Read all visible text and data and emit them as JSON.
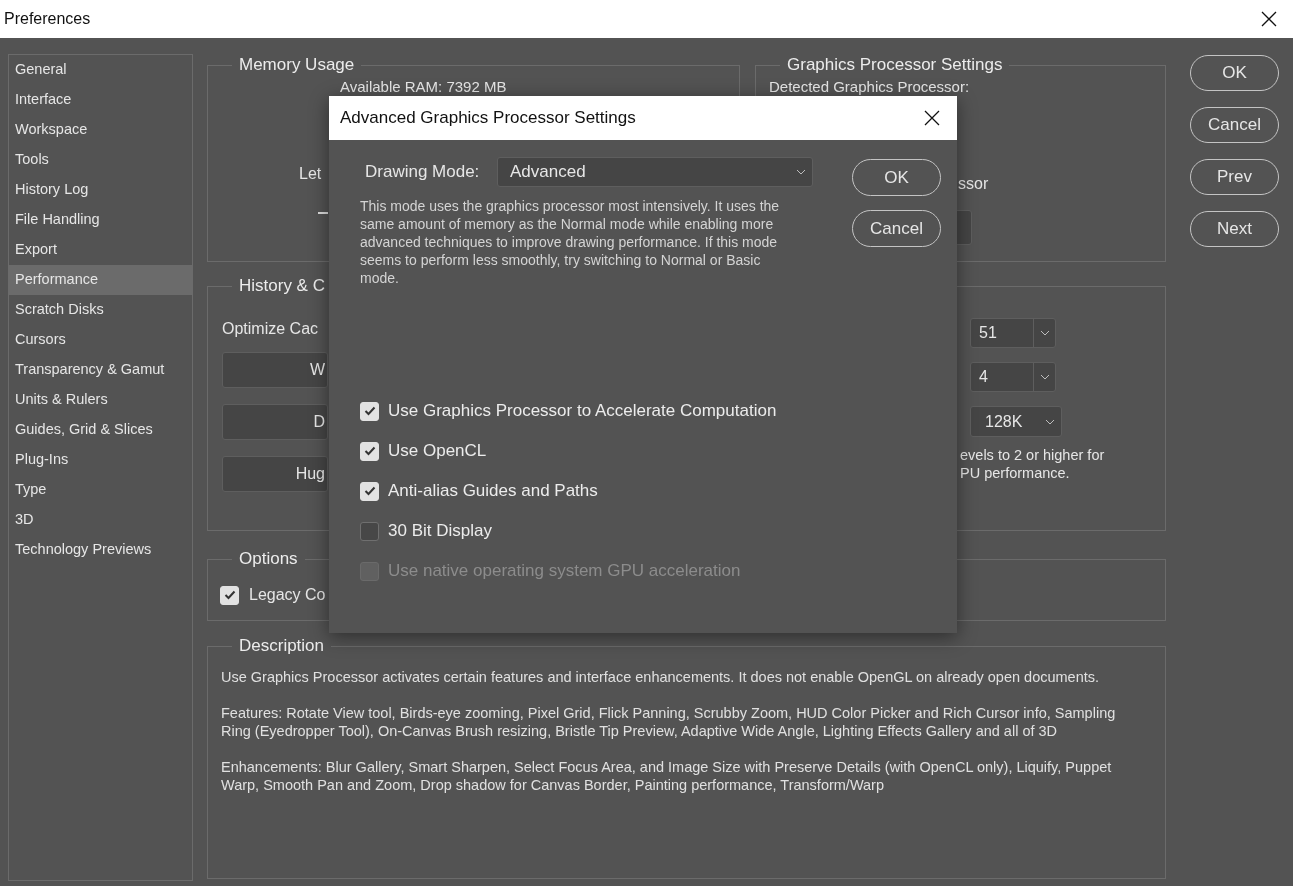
{
  "window": {
    "title": "Preferences"
  },
  "sidebar": {
    "items": [
      {
        "label": "General",
        "selected": false
      },
      {
        "label": "Interface",
        "selected": false
      },
      {
        "label": "Workspace",
        "selected": false
      },
      {
        "label": "Tools",
        "selected": false
      },
      {
        "label": "History Log",
        "selected": false
      },
      {
        "label": "File Handling",
        "selected": false
      },
      {
        "label": "Export",
        "selected": false
      },
      {
        "label": "Performance",
        "selected": true
      },
      {
        "label": "Scratch Disks",
        "selected": false
      },
      {
        "label": "Cursors",
        "selected": false
      },
      {
        "label": "Transparency & Gamut",
        "selected": false
      },
      {
        "label": "Units & Rulers",
        "selected": false
      },
      {
        "label": "Guides, Grid & Slices",
        "selected": false
      },
      {
        "label": "Plug-Ins",
        "selected": false
      },
      {
        "label": "Type",
        "selected": false
      },
      {
        "label": "3D",
        "selected": false
      },
      {
        "label": "Technology Previews",
        "selected": false
      }
    ]
  },
  "memory_usage": {
    "title": "Memory Usage",
    "available_ram": "Available RAM:  7392 MB",
    "let_label": "Let"
  },
  "graphics_processor": {
    "title": "Graphics Processor Settings",
    "detected_label": "Detected Graphics Processor:",
    "use_gpu_label": "ssor"
  },
  "history_cache": {
    "title": "History & C",
    "optimize_label": "Optimize Cac",
    "presets": [
      "W",
      "D",
      "Hug"
    ],
    "dropdowns": [
      {
        "value": "51"
      },
      {
        "value": "4"
      },
      {
        "value": "128K"
      }
    ],
    "note": [
      "evels to 2 or higher for",
      "PU performance."
    ]
  },
  "options": {
    "title": "Options",
    "items": [
      {
        "label": "Legacy Co",
        "checked": true
      }
    ]
  },
  "description": {
    "title": "Description",
    "paragraphs": [
      "Use Graphics Processor activates certain features and interface enhancements. It does not enable OpenGL on already open documents.",
      "Features: Rotate View tool, Birds-eye zooming, Pixel Grid, Flick Panning, Scrubby Zoom, HUD Color Picker and Rich Cursor info, Sampling Ring (Eyedropper Tool), On-Canvas Brush resizing, Bristle Tip Preview, Adaptive Wide Angle, Lighting Effects Gallery and all of 3D",
      "Enhancements: Blur Gallery, Smart Sharpen, Select Focus Area, and Image Size with Preserve Details (with OpenCL only), Liquify, Puppet Warp, Smooth Pan and Zoom, Drop shadow for Canvas Border, Painting performance, Transform/Warp"
    ]
  },
  "buttons": [
    "OK",
    "Cancel",
    "Prev",
    "Next"
  ],
  "dialog": {
    "title": "Advanced Graphics Processor Settings",
    "drawing_mode_label": "Drawing Mode:",
    "drawing_mode_value": "Advanced",
    "mode_description": "This mode uses the graphics processor most intensively.  It uses the same amount of memory as the Normal mode while enabling more advanced techniques to improve drawing performance.  If this mode seems to perform less smoothly, try switching to Normal or Basic mode.",
    "buttons": [
      "OK",
      "Cancel"
    ],
    "checkboxes": [
      {
        "label": "Use Graphics Processor to Accelerate Computation",
        "checked": true,
        "disabled": false
      },
      {
        "label": "Use OpenCL",
        "checked": true,
        "disabled": false
      },
      {
        "label": "Anti-alias Guides and Paths",
        "checked": true,
        "disabled": false
      },
      {
        "label": "30 Bit Display",
        "checked": false,
        "disabled": false
      },
      {
        "label": "Use native operating system GPU acceleration",
        "checked": false,
        "disabled": true
      }
    ]
  }
}
